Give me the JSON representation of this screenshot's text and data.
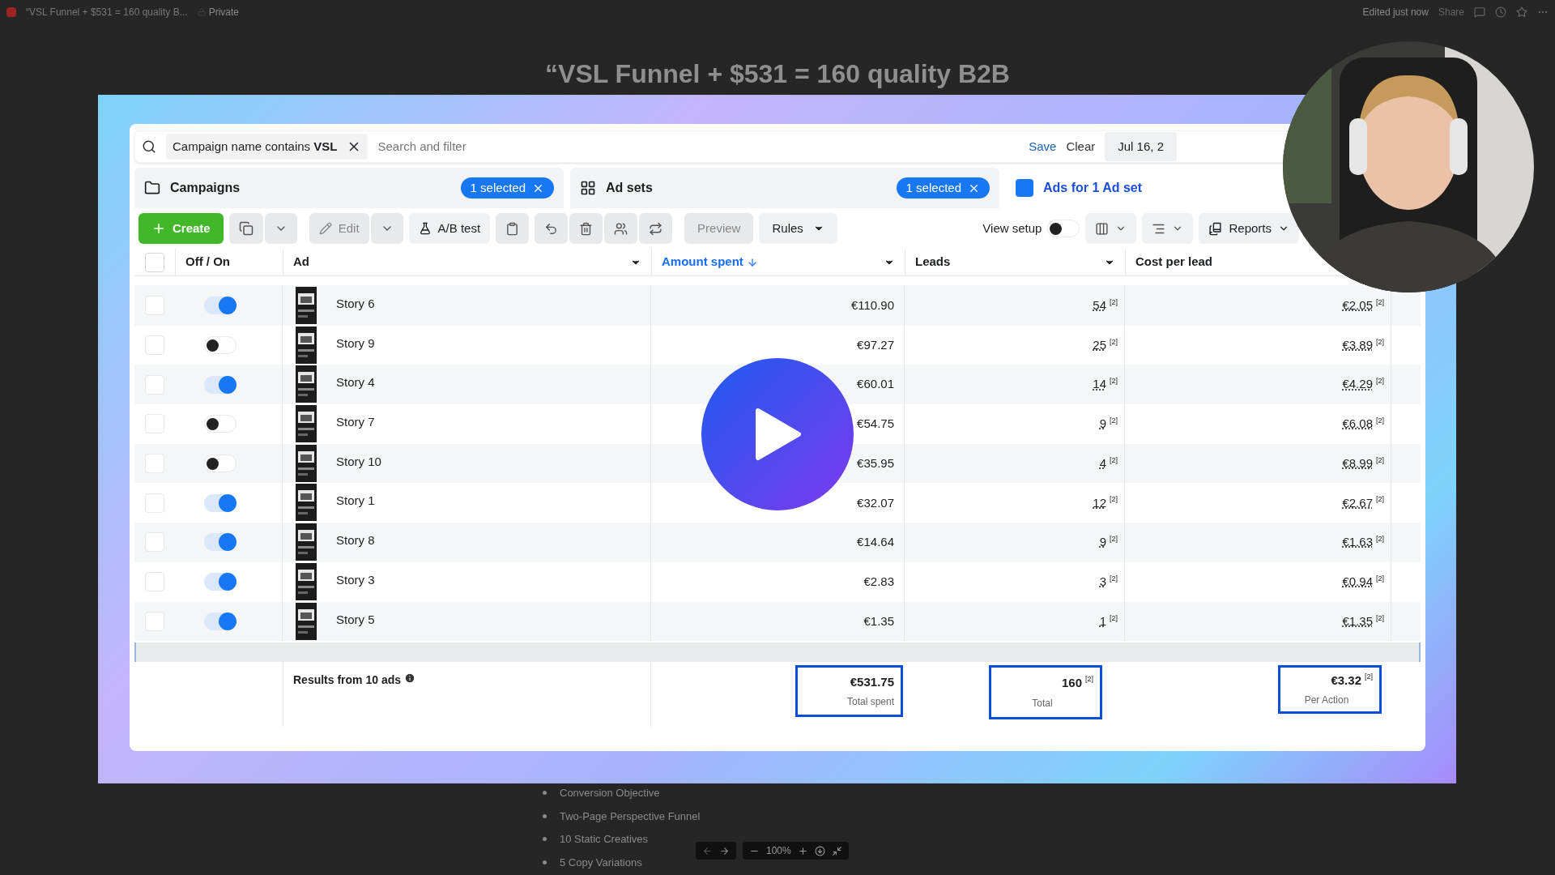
{
  "top_bar": {
    "doc_title": "“VSL Funnel + $531 = 160 quality B...",
    "privacy": "Private",
    "status": "Edited just now",
    "share": "Share"
  },
  "heading": "“VSL Funnel + $531 = 160 quality B2B",
  "filter_bar": {
    "chip": "Campaign name contains **VSL**",
    "placeholder": "Search and filter",
    "save": "Save",
    "clear": "Clear",
    "date": "Jul 16, 2"
  },
  "levels": [
    {
      "label": "Campaigns",
      "badge": "1 selected",
      "selected": false
    },
    {
      "label": "Ad sets",
      "badge": "1 selected",
      "selected": false
    },
    {
      "label": "Ads for 1 Ad set",
      "selected": true
    }
  ],
  "toolbar": {
    "create": "Create",
    "edit": "Edit",
    "ab_test": "A/B test",
    "preview": "Preview",
    "rules": "Rules",
    "view_setup": "View setup",
    "view_setup_on": false,
    "reports": "Reports"
  },
  "table": {
    "select_all_checked": false,
    "columns": [
      {
        "label": "Off / On",
        "sorted": false
      },
      {
        "label": "Ad",
        "sorted": false
      },
      {
        "label": "Amount spent",
        "sorted": true
      },
      {
        "label": "Leads",
        "sorted": false
      },
      {
        "label": "Cost per lead",
        "sorted": false
      }
    ],
    "rows": [
      {
        "checked": false,
        "on": true,
        "name": "Story 6",
        "amount": "€110.90",
        "leads": "54",
        "leads_note": "[2]",
        "cost": "€2.05",
        "cost_note": "[2]"
      },
      {
        "checked": false,
        "on": false,
        "name": "Story 9",
        "amount": "€97.27",
        "leads": "25",
        "leads_note": "[2]",
        "cost": "€3.89",
        "cost_note": "[2]"
      },
      {
        "checked": false,
        "on": true,
        "name": "Story 4",
        "amount": "€60.01",
        "leads": "14",
        "leads_note": "[2]",
        "cost": "€4.29",
        "cost_note": "[2]"
      },
      {
        "checked": false,
        "on": false,
        "name": "Story 7",
        "amount": "€54.75",
        "leads": "9",
        "leads_note": "[2]",
        "cost": "€6.08",
        "cost_note": "[2]"
      },
      {
        "checked": false,
        "on": false,
        "name": "Story 10",
        "amount": "€35.95",
        "leads": "4",
        "leads_note": "[2]",
        "cost": "€8.99",
        "cost_note": "[2]"
      },
      {
        "checked": false,
        "on": true,
        "name": "Story 1",
        "amount": "€32.07",
        "leads": "12",
        "leads_note": "[2]",
        "cost": "€2.67",
        "cost_note": "[2]"
      },
      {
        "checked": false,
        "on": true,
        "name": "Story 8",
        "amount": "€14.64",
        "leads": "9",
        "leads_note": "[2]",
        "cost": "€1.63",
        "cost_note": "[2]"
      },
      {
        "checked": false,
        "on": true,
        "name": "Story 3",
        "amount": "€2.83",
        "leads": "3",
        "leads_note": "[2]",
        "cost": "€0.94",
        "cost_note": "[2]"
      },
      {
        "checked": false,
        "on": true,
        "name": "Story 5",
        "amount": "€1.35",
        "leads": "1",
        "leads_note": "[2]",
        "cost": "€1.35",
        "cost_note": "[2]"
      }
    ],
    "summary": {
      "label": "Results from 10 ads",
      "cells": [
        {
          "value": "€531.75",
          "caption": "Total spent"
        },
        {
          "value": "160",
          "note": "[2]",
          "caption": "Total"
        },
        {
          "value": "€3.32",
          "note": "[2]",
          "caption": "Per Action"
        }
      ]
    }
  },
  "notes": [
    "Conversion Objective",
    "Two-Page Perspective Funnel",
    "10 Static Creatives",
    "5 Copy Variations"
  ],
  "zoom_controls": {
    "zoom": "100%"
  }
}
